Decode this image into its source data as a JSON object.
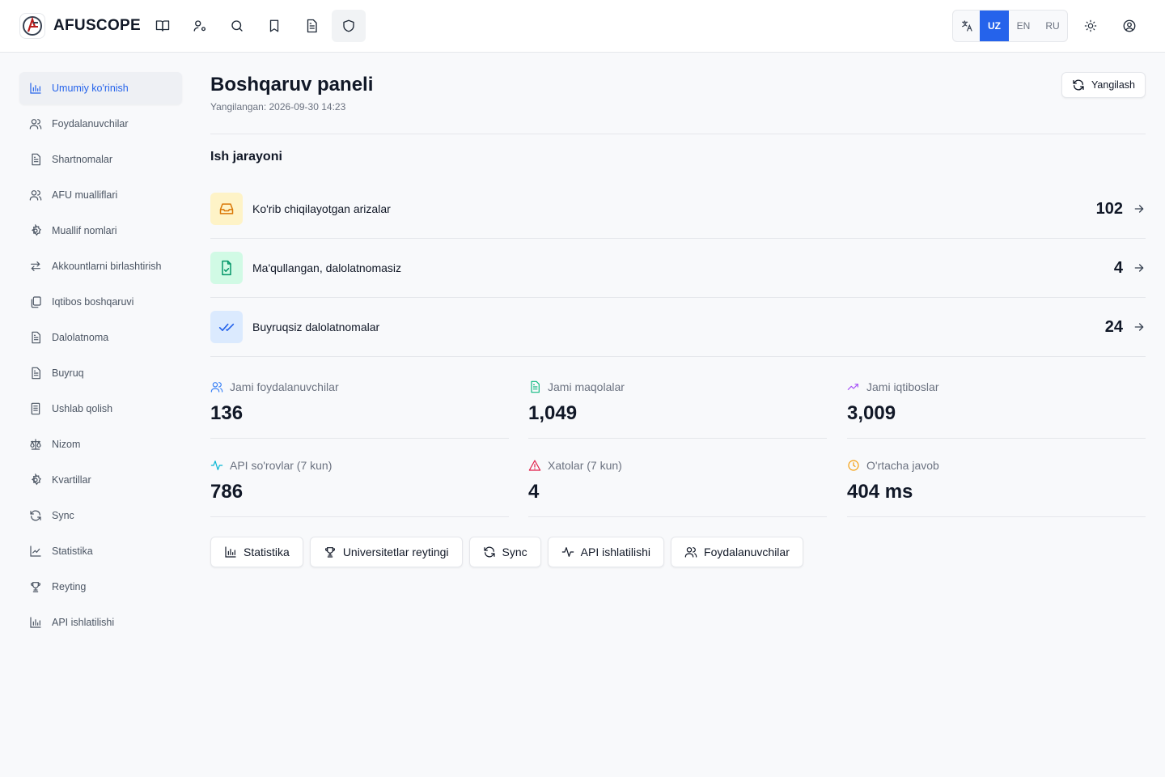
{
  "app": {
    "name": "AFUSCOPE"
  },
  "topnav": [
    {
      "icon": "book-open-icon"
    },
    {
      "icon": "user-cog-icon"
    },
    {
      "icon": "search-icon"
    },
    {
      "icon": "bookmark-icon"
    },
    {
      "icon": "file-text-icon"
    },
    {
      "icon": "shield-icon",
      "active": true
    }
  ],
  "language": {
    "options": [
      "UZ",
      "EN",
      "RU"
    ],
    "selected": "UZ",
    "icon": "translate-icon"
  },
  "sidebar": {
    "items": [
      {
        "label": "Umumiy ko'rinish",
        "icon": "bar-chart-icon",
        "active": true
      },
      {
        "label": "Foydalanuvchilar",
        "icon": "users-icon"
      },
      {
        "label": "Shartnomalar",
        "icon": "file-text-icon"
      },
      {
        "label": "AFU mualliflari",
        "icon": "users-icon"
      },
      {
        "label": "Muallif nomlari",
        "icon": "settings-icon"
      },
      {
        "label": "Akkountlarni birlashtirish",
        "icon": "arrows-swap-icon"
      },
      {
        "label": "Iqtibos boshqaruvi",
        "icon": "copy-icon"
      },
      {
        "label": "Dalolatnoma",
        "icon": "file-text-icon"
      },
      {
        "label": "Buyruq",
        "icon": "file-text-icon"
      },
      {
        "label": "Ushlab qolish",
        "icon": "file-list-icon"
      },
      {
        "label": "Nizom",
        "icon": "scale-icon"
      },
      {
        "label": "Kvartillar",
        "icon": "settings-icon"
      },
      {
        "label": "Sync",
        "icon": "refresh-icon"
      },
      {
        "label": "Statistika",
        "icon": "line-chart-icon"
      },
      {
        "label": "Reyting",
        "icon": "trophy-icon"
      },
      {
        "label": "API ishlatilishi",
        "icon": "bar-chart-icon"
      }
    ]
  },
  "header": {
    "title": "Boshqaruv paneli",
    "updated": "Yangilangan: 2026-09-30 14:23",
    "refresh_label": "Yangilash"
  },
  "workflow": {
    "title": "Ish jarayoni",
    "items": [
      {
        "label": "Ko'rib chiqilayotgan arizalar",
        "count": "102",
        "icon": "inbox-icon",
        "bg": "#fef3c7",
        "color": "#d97706"
      },
      {
        "label": "Ma'qullangan, dalolatnomasiz",
        "count": "4",
        "icon": "file-check-icon",
        "bg": "#d1fae5",
        "color": "#059669"
      },
      {
        "label": "Buyruqsiz dalolatnomalar",
        "count": "24",
        "icon": "double-check-icon",
        "bg": "#dbeafe",
        "color": "#2563eb"
      }
    ]
  },
  "stats": [
    {
      "label": "Jami foydalanuvchilar",
      "value": "136",
      "icon": "users-icon",
      "color": "#3b82f6"
    },
    {
      "label": "Jami maqolalar",
      "value": "1,049",
      "icon": "file-text-icon",
      "color": "#10b981"
    },
    {
      "label": "Jami iqtiboslar",
      "value": "3,009",
      "icon": "trending-up-icon",
      "color": "#a855f7"
    },
    {
      "label": "API so'rovlar (7 kun)",
      "value": "786",
      "icon": "activity-icon",
      "color": "#06b6d4"
    },
    {
      "label": "Xatolar (7 kun)",
      "value": "4",
      "icon": "alert-triangle-icon",
      "color": "#e11d48"
    },
    {
      "label": "O'rtacha javob",
      "value": "404 ms",
      "icon": "clock-icon",
      "color": "#f59e0b"
    }
  ],
  "quick_links": [
    {
      "label": "Statistika",
      "icon": "bar-chart-icon"
    },
    {
      "label": "Universitetlar reytingi",
      "icon": "trophy-icon"
    },
    {
      "label": "Sync",
      "icon": "refresh-icon"
    },
    {
      "label": "API ishlatilishi",
      "icon": "activity-icon"
    },
    {
      "label": "Foydalanuvchilar",
      "icon": "users-icon"
    }
  ],
  "colors": {
    "accent": "#2563eb",
    "border": "#e5e7eb",
    "background": "#f8f9fb"
  }
}
